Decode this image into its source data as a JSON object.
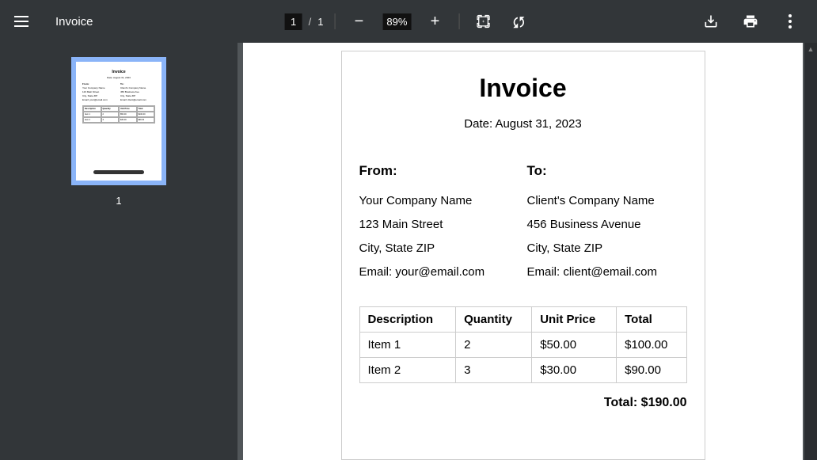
{
  "header": {
    "title": "Invoice",
    "page_current": "1",
    "page_sep": "/",
    "page_total": "1",
    "zoom": "89%"
  },
  "sidebar": {
    "thumb_label": "1"
  },
  "invoice": {
    "title": "Invoice",
    "date": "Date: August 31, 2023",
    "from": {
      "heading": "From:",
      "name": "Your Company Name",
      "street": "123 Main Street",
      "city": "City, State ZIP",
      "email": "Email: your@email.com"
    },
    "to": {
      "heading": "To:",
      "name": "Client's Company Name",
      "street": "456 Business Avenue",
      "city": "City, State ZIP",
      "email": "Email: client@email.com"
    },
    "table": {
      "headers": {
        "desc": "Description",
        "qty": "Quantity",
        "price": "Unit Price",
        "total": "Total"
      },
      "rows": [
        {
          "desc": "Item 1",
          "qty": "2",
          "price": "$50.00",
          "total": "$100.00"
        },
        {
          "desc": "Item 2",
          "qty": "3",
          "price": "$30.00",
          "total": "$90.00"
        }
      ]
    },
    "grand_total": "Total: $190.00"
  }
}
